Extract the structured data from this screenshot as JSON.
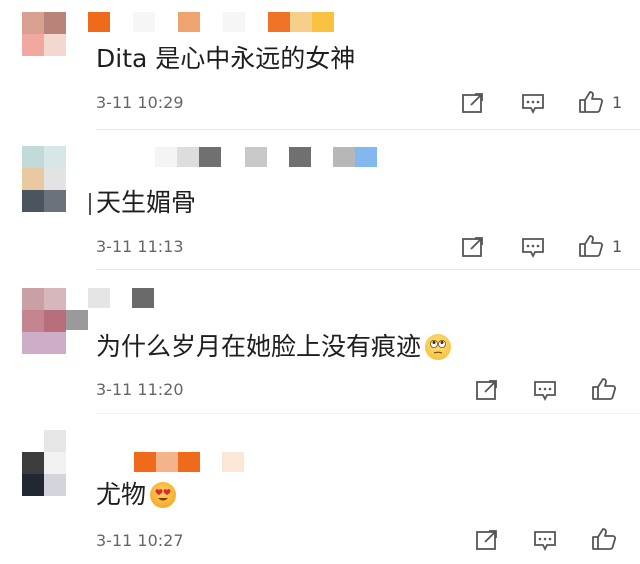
{
  "comments": [
    {
      "text": "Dita 是心中永远的女神",
      "time": "3-11 10:29",
      "likes": "1"
    },
    {
      "text": "天生媚骨",
      "time": "3-11 11:13",
      "likes": "1"
    },
    {
      "text": "为什么岁月在她脸上没有痕迹",
      "time": "3-11 11:20",
      "likes": ""
    },
    {
      "text": "尤物",
      "time": "3-11 10:27",
      "likes": ""
    }
  ],
  "icons": {
    "share": "share-icon",
    "comment": "comment-icon",
    "like": "thumbs-up-icon",
    "emoji3": "rolling-eyes-emoji-icon",
    "emoji4": "heart-eyes-emoji-icon"
  },
  "colors": {
    "text": "#1e1e1e",
    "meta": "#666666",
    "icon": "#555555",
    "divider": "#e9e9e9"
  }
}
